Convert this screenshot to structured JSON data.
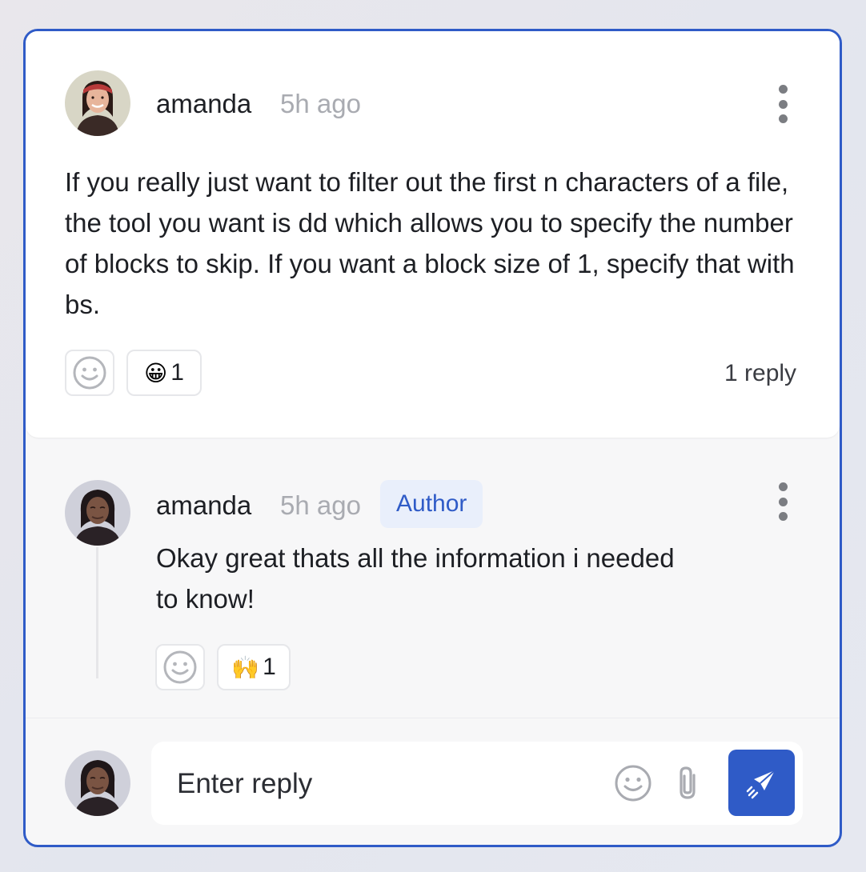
{
  "comment": {
    "author": "amanda",
    "time": "5h ago",
    "text": "If you really just want to filter out the first n characters of a file, the tool you want is dd which allows you to specify the number of blocks to skip. If you want a block size of 1, specify that with bs.",
    "reactions": [
      {
        "emoji": "😀",
        "count": "1"
      }
    ],
    "reply_count": "1 reply"
  },
  "reply": {
    "author": "amanda",
    "time": "5h ago",
    "badge": "Author",
    "text": "Okay great thats all the information i needed to know!",
    "reactions": [
      {
        "emoji": "🙌",
        "count": "1"
      }
    ]
  },
  "composer": {
    "placeholder": "Enter reply"
  },
  "icons": {
    "emoji_picker": "smiley-icon",
    "attach": "paperclip-icon",
    "send": "paper-plane-icon",
    "more": "vertical-dots-icon"
  },
  "colors": {
    "accent": "#2f5bc7",
    "badge_bg": "#e9effb",
    "muted_text": "#a9abb1"
  }
}
